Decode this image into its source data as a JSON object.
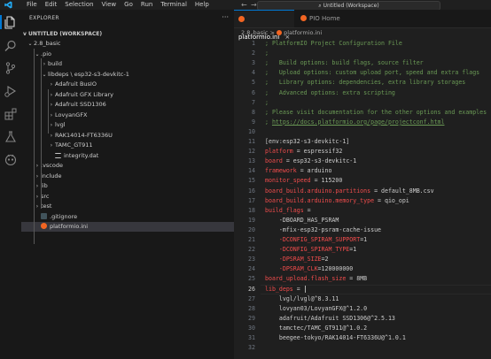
{
  "menu": [
    "File",
    "Edit",
    "Selection",
    "View",
    "Go",
    "Run",
    "Terminal",
    "Help"
  ],
  "title_search": "Untitled (Workspace)",
  "explorer": {
    "title": "EXPLORER",
    "workspace": "UNTITLED (WORKSPACE)",
    "items": [
      {
        "label": "2.8_basic",
        "chevron": "v",
        "indent": 0,
        "kind": "folder"
      },
      {
        "label": ".pio",
        "chevron": "v",
        "indent": 1,
        "kind": "folder"
      },
      {
        "label": "build",
        "chevron": ">",
        "indent": 2,
        "kind": "folder"
      },
      {
        "label": "libdeps \\ esp32-s3-devkitc-1",
        "chevron": "v",
        "indent": 2,
        "kind": "folder"
      },
      {
        "label": "Adafruit BusIO",
        "chevron": ">",
        "indent": 3,
        "kind": "folder"
      },
      {
        "label": "Adafruit GFX Library",
        "chevron": ">",
        "indent": 3,
        "kind": "folder"
      },
      {
        "label": "Adafruit SSD1306",
        "chevron": ">",
        "indent": 3,
        "kind": "folder"
      },
      {
        "label": "LovyanGFX",
        "chevron": ">",
        "indent": 3,
        "kind": "folder"
      },
      {
        "label": "lvgl",
        "chevron": ">",
        "indent": 3,
        "kind": "folder"
      },
      {
        "label": "RAK14014-FT6336U",
        "chevron": ">",
        "indent": 3,
        "kind": "folder"
      },
      {
        "label": "TAMC_GT911",
        "chevron": ">",
        "indent": 3,
        "kind": "folder"
      },
      {
        "label": "integrity.dat",
        "chevron": "",
        "indent": 3,
        "kind": "file-lines"
      },
      {
        "label": ".vscode",
        "chevron": ">",
        "indent": 1,
        "kind": "folder"
      },
      {
        "label": "include",
        "chevron": ">",
        "indent": 1,
        "kind": "folder"
      },
      {
        "label": "lib",
        "chevron": ">",
        "indent": 1,
        "kind": "folder"
      },
      {
        "label": "src",
        "chevron": ">",
        "indent": 1,
        "kind": "folder"
      },
      {
        "label": "test",
        "chevron": ">",
        "indent": 1,
        "kind": "folder"
      },
      {
        "label": ".gitignore",
        "chevron": "",
        "indent": 1,
        "kind": "file-git"
      },
      {
        "label": "platformio.ini",
        "chevron": "",
        "indent": 1,
        "kind": "file-pio",
        "selected": true
      }
    ]
  },
  "tabs": [
    {
      "label": "platformio.ini",
      "active": true,
      "close": "×"
    },
    {
      "label": "PIO Home",
      "active": false,
      "close": ""
    }
  ],
  "breadcrumb": {
    "folder": "2.8_basic",
    "sep": ">",
    "file": "platformio.ini"
  },
  "editor": {
    "current_line": 26,
    "lines": [
      {
        "n": 1,
        "parts": [
          {
            "t": "; PlatformIO Project Configuration File",
            "c": "com"
          }
        ]
      },
      {
        "n": 2,
        "parts": [
          {
            "t": ";",
            "c": "com"
          }
        ]
      },
      {
        "n": 3,
        "parts": [
          {
            "t": ";   Build options: build flags, source filter",
            "c": "com"
          }
        ]
      },
      {
        "n": 4,
        "parts": [
          {
            "t": ";   Upload options: custom upload port, speed and extra flags",
            "c": "com"
          }
        ]
      },
      {
        "n": 5,
        "parts": [
          {
            "t": ";   Library options: dependencies, extra library storages",
            "c": "com"
          }
        ]
      },
      {
        "n": 6,
        "parts": [
          {
            "t": ";   Advanced options: extra scripting",
            "c": "com"
          }
        ]
      },
      {
        "n": 7,
        "parts": [
          {
            "t": ";",
            "c": "com"
          }
        ]
      },
      {
        "n": 8,
        "parts": [
          {
            "t": "; Please visit documentation for the other options and examples",
            "c": "com"
          }
        ]
      },
      {
        "n": 9,
        "parts": [
          {
            "t": "; ",
            "c": "com"
          },
          {
            "t": "https://docs.platformio.org/page/projectconf.html",
            "c": "link"
          }
        ]
      },
      {
        "n": 10,
        "parts": []
      },
      {
        "n": 11,
        "parts": [
          {
            "t": "[env:esp32-s3-devkitc-1]",
            "c": "sec"
          }
        ]
      },
      {
        "n": 12,
        "parts": [
          {
            "t": "platform",
            "c": "key"
          },
          {
            "t": " = espressif32",
            "c": "val"
          }
        ]
      },
      {
        "n": 13,
        "parts": [
          {
            "t": "board",
            "c": "key"
          },
          {
            "t": " = esp32-s3-devkitc-1",
            "c": "val"
          }
        ]
      },
      {
        "n": 14,
        "parts": [
          {
            "t": "framework",
            "c": "key"
          },
          {
            "t": " = arduino",
            "c": "val"
          }
        ]
      },
      {
        "n": 15,
        "parts": [
          {
            "t": "monitor_speed",
            "c": "key"
          },
          {
            "t": " = 115200",
            "c": "val"
          }
        ]
      },
      {
        "n": 16,
        "parts": [
          {
            "t": "board_build.arduino.partitions",
            "c": "key"
          },
          {
            "t": " = default_8MB.csv",
            "c": "val"
          }
        ]
      },
      {
        "n": 17,
        "parts": [
          {
            "t": "board_build.arduino.memory_type",
            "c": "key"
          },
          {
            "t": " = qio_opi",
            "c": "val"
          }
        ]
      },
      {
        "n": 18,
        "parts": [
          {
            "t": "build_flags",
            "c": "key"
          },
          {
            "t": " =",
            "c": "val"
          }
        ]
      },
      {
        "n": 19,
        "parts": [
          {
            "t": "    -DBOARD_HAS_PSRAM",
            "c": "val"
          }
        ]
      },
      {
        "n": 20,
        "parts": [
          {
            "t": "    -mfix-esp32-psram-cache-issue",
            "c": "val"
          }
        ]
      },
      {
        "n": 21,
        "parts": [
          {
            "t": "    -DCONFIG_SPIRAM_SUPPORT",
            "c": "key"
          },
          {
            "t": "=1",
            "c": "val"
          }
        ]
      },
      {
        "n": 22,
        "parts": [
          {
            "t": "    -DCONFIG_SPIRAM_TYPE",
            "c": "key"
          },
          {
            "t": "=1",
            "c": "val"
          }
        ]
      },
      {
        "n": 23,
        "parts": [
          {
            "t": "    -DPSRAM_SIZE",
            "c": "key"
          },
          {
            "t": "=2",
            "c": "val"
          }
        ]
      },
      {
        "n": 24,
        "parts": [
          {
            "t": "    -DPSRAM_CLK",
            "c": "key"
          },
          {
            "t": "=120000000",
            "c": "val"
          }
        ]
      },
      {
        "n": 25,
        "parts": [
          {
            "t": "board_upload.flash_size",
            "c": "key"
          },
          {
            "t": " = 8MB",
            "c": "val"
          }
        ]
      },
      {
        "n": 26,
        "parts": [
          {
            "t": "lib_deps",
            "c": "key"
          },
          {
            "t": " = ",
            "c": "val"
          }
        ]
      },
      {
        "n": 27,
        "parts": [
          {
            "t": "    lvgl/lvgl@^8.3.11",
            "c": "val"
          }
        ]
      },
      {
        "n": 28,
        "parts": [
          {
            "t": "    lovyan03/LovyanGFX@^1.2.0",
            "c": "val"
          }
        ]
      },
      {
        "n": 29,
        "parts": [
          {
            "t": "    adafruit/Adafruit SSD1306@^2.5.13",
            "c": "val"
          }
        ]
      },
      {
        "n": 30,
        "parts": [
          {
            "t": "    tamctec/TAMC_GT911@^1.0.2",
            "c": "val"
          }
        ]
      },
      {
        "n": 31,
        "parts": [
          {
            "t": "    beegee-tokyo/RAK14014-FT6336U@^1.0.1",
            "c": "val"
          }
        ]
      },
      {
        "n": 32,
        "parts": []
      }
    ]
  }
}
